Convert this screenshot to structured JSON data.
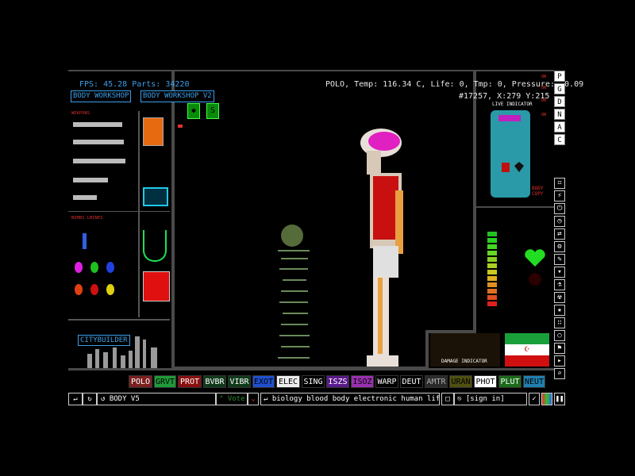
{
  "hud": {
    "fps_line": "FPS: 45.28 Parts: 34220",
    "info_line": "POLO, Temp: 116.34 C, Life: 0, Tmp: 0, Pressure: -0.09",
    "coord_line": "#17257, X:279 Y:215"
  },
  "saves": {
    "tab1": "BODY WORKSHOP",
    "tab2": "BODY WORKSHOP V2"
  },
  "panels": {
    "weapons_label": "WEAPONS",
    "bombs_label": "BOMBS LMINES",
    "citybuilder_label": "CITYBUILDER",
    "live_indicator_label": "LIVE INDICATOR",
    "body_copy_label": "BODY COPY",
    "damage_indicator_label": "DAMAGE INDICATOR"
  },
  "on_labels": [
    "ON",
    "ON",
    "ON",
    "ON"
  ],
  "side_buttons": [
    "P",
    "G",
    "D",
    "N",
    "A",
    "C"
  ],
  "tool_icons": [
    "grid-icon",
    "plug-icon",
    "power-icon",
    "clock-icon",
    "arrows-icon",
    "wrench-icon",
    "pen-icon",
    "drop-icon",
    "flask-icon",
    "radiation-icon",
    "star-icon",
    "dots-icon",
    "bulb-icon",
    "flag-icon",
    "cursor-icon",
    "search-icon"
  ],
  "elements": [
    {
      "label": "POLO",
      "bg": "#7a2020",
      "fg": "#ffffff"
    },
    {
      "label": "GRVT",
      "bg": "#1e9a3a",
      "fg": "#000000"
    },
    {
      "label": "PROT",
      "bg": "#8a1010",
      "fg": "#ffffff"
    },
    {
      "label": "BVBR",
      "bg": "#0f3a1a",
      "fg": "#ffffff"
    },
    {
      "label": "VIBR",
      "bg": "#0f3a1a",
      "fg": "#ffffff"
    },
    {
      "label": "EXOT",
      "bg": "#2050d0",
      "fg": "#000000"
    },
    {
      "label": "ELEC",
      "bg": "#eeeeee",
      "fg": "#000000"
    },
    {
      "label": "SING",
      "bg": "#000000",
      "fg": "#ffffff"
    },
    {
      "label": "ISZS",
      "bg": "#5a1a8a",
      "fg": "#ffffff"
    },
    {
      "label": "ISOZ",
      "bg": "#9a30b0",
      "fg": "#000000"
    },
    {
      "label": "WARP",
      "bg": "#000000",
      "fg": "#ffffff"
    },
    {
      "label": "DEUT",
      "bg": "#000000",
      "fg": "#ffffff"
    },
    {
      "label": "AMTR",
      "bg": "#2a2a2a",
      "fg": "#aaaaaa"
    },
    {
      "label": "URAN",
      "bg": "#505010",
      "fg": "#000000"
    },
    {
      "label": "PHOT",
      "bg": "#ffffff",
      "fg": "#000000"
    },
    {
      "label": "PLUT",
      "bg": "#1a6a1a",
      "fg": "#ffffff"
    },
    {
      "label": "NEUT",
      "bg": "#2080b0",
      "fg": "#000000"
    }
  ],
  "bottom": {
    "save_name": "BODY V5",
    "vote_label": "Vote",
    "tags": "biology blood body electronic human life...",
    "signin": "[sign in]"
  },
  "colors": {
    "accent_blue": "#3c9ee8",
    "warning_red": "#e23030",
    "wall_gray": "#4a4a4a",
    "heart_green": "#22dd22"
  },
  "health_bar_levels": 12
}
